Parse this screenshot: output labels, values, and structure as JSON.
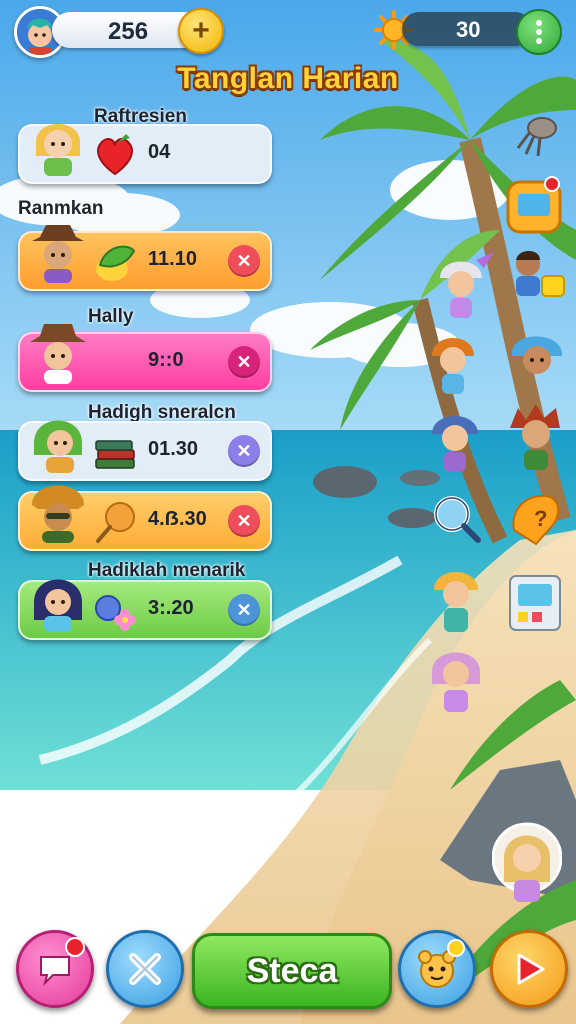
{
  "header": {
    "coins": "256",
    "energy": "30",
    "plus_icon": "plus-icon",
    "sun_icon": "sun-icon",
    "menu_icon": "vertical-dots-icon"
  },
  "title": "Tanglan Harian",
  "cards": [
    {
      "label": "Raftresien",
      "value": "04",
      "item_icon": "heart-icon",
      "color": "#e3edf7",
      "close": false
    },
    {
      "label": "Ranmkan",
      "value": "11.10",
      "item_icon": "leaf-icon",
      "color": "#ffb34d",
      "close": true
    },
    {
      "label": "Hally",
      "value": "9::0",
      "item_icon": "none",
      "color": "#ff5fb1",
      "close": true
    },
    {
      "label": "Hadigh sneralcn",
      "value": "01.30",
      "item_icon": "book-stack-icon",
      "color": "#e3edf7",
      "close": true
    },
    {
      "label": "",
      "value": "4.ẞ.30",
      "item_icon": "lollipop-icon",
      "color": "#ffbf52",
      "close": true
    },
    {
      "label": "Hadiklah menarik",
      "value": "3:.20",
      "item_icon": "flower-icon",
      "color": "#8fdc6a",
      "close": true
    }
  ],
  "bottom": {
    "chat_icon": "chat-bubble-icon",
    "close_icon": "close-icon",
    "main_button": "Steca",
    "pet_icon": "pet-face-icon",
    "play_icon": "play-icon"
  },
  "colors": {
    "accent_yellow": "#ffd23c",
    "green": "#3cb521",
    "pink": "#ff5fb1",
    "sky": "#59b6ee",
    "sea": "#2fc3c9",
    "sand": "#f2d7a8"
  }
}
